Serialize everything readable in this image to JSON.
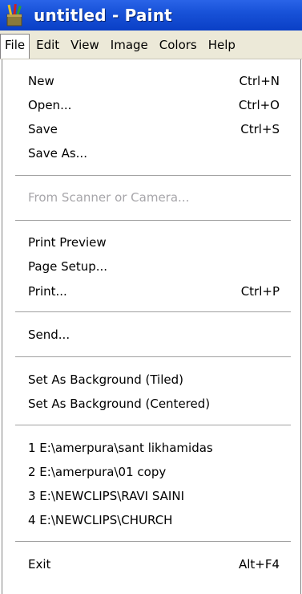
{
  "window": {
    "title": "untitled - Paint",
    "icon": "paint-app-icon"
  },
  "menubar": {
    "items": [
      "File",
      "Edit",
      "View",
      "Image",
      "Colors",
      "Help"
    ],
    "active": "File"
  },
  "file_menu": {
    "new": {
      "label": "New",
      "shortcut": "Ctrl+N"
    },
    "open": {
      "label": "Open...",
      "shortcut": "Ctrl+O"
    },
    "save": {
      "label": "Save",
      "shortcut": "Ctrl+S"
    },
    "save_as": {
      "label": "Save As..."
    },
    "from_scanner": {
      "label": "From Scanner or Camera...",
      "disabled": true
    },
    "print_preview": {
      "label": "Print Preview"
    },
    "page_setup": {
      "label": "Page Setup..."
    },
    "print": {
      "label": "Print...",
      "shortcut": "Ctrl+P"
    },
    "send": {
      "label": "Send..."
    },
    "bg_tiled": {
      "label": "Set As Background (Tiled)"
    },
    "bg_centered": {
      "label": "Set As Background (Centered)"
    },
    "recent": [
      "1 E:\\amerpura\\sant likhamidas",
      "2 E:\\amerpura\\01 copy",
      "3 E:\\NEWCLIPS\\RAVI SAINI",
      "4 E:\\NEWCLIPS\\CHURCH"
    ],
    "exit": {
      "label": "Exit",
      "shortcut": "Alt+F4"
    }
  },
  "colors": {
    "titlebar": "#1852d8",
    "menubar": "#ece9d8",
    "disabled_text": "#a7a6aa"
  }
}
